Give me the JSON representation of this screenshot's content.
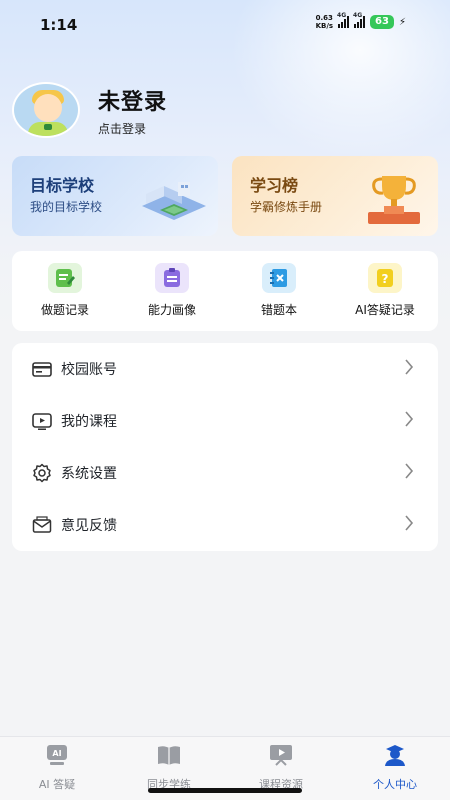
{
  "status_bar": {
    "time": "1:14",
    "net_speed_value": "0.63",
    "net_speed_unit": "KB/s",
    "signal1_label": "4G",
    "signal2_label": "4G",
    "battery": "63"
  },
  "profile": {
    "name": "未登录",
    "login_hint": "点击登录"
  },
  "cards": {
    "target": {
      "title": "目标学校",
      "subtitle": "我的目标学校"
    },
    "rank": {
      "title": "学习榜",
      "subtitle": "学霸修炼手册"
    }
  },
  "quick_actions": [
    {
      "label": "做题记录",
      "icon": "pencil-note-icon",
      "color": "#9fd98c"
    },
    {
      "label": "能力画像",
      "icon": "clipboard-icon",
      "color": "#b9a6f0"
    },
    {
      "label": "错题本",
      "icon": "error-notebook-icon",
      "color": "#7cc5f2"
    },
    {
      "label": "AI答疑记录",
      "icon": "question-card-icon",
      "color": "#f7e36a"
    }
  ],
  "menu": [
    {
      "label": "校园账号",
      "icon": "campus-card-icon"
    },
    {
      "label": "我的课程",
      "icon": "video-course-icon"
    },
    {
      "label": "系统设置",
      "icon": "gear-icon"
    },
    {
      "label": "意见反馈",
      "icon": "mail-feedback-icon"
    }
  ],
  "tabbar": [
    {
      "label": "AI 答疑",
      "icon": "ai-chat-icon",
      "active": false
    },
    {
      "label": "同步学练",
      "icon": "book-icon",
      "active": false
    },
    {
      "label": "课程资源",
      "icon": "video-board-icon",
      "active": false
    },
    {
      "label": "个人中心",
      "icon": "graduate-user-icon",
      "active": true
    }
  ],
  "colors": {
    "accent": "#1d58c9",
    "inactive_tab": "#8a8d93",
    "background": "#f3f4f6"
  }
}
